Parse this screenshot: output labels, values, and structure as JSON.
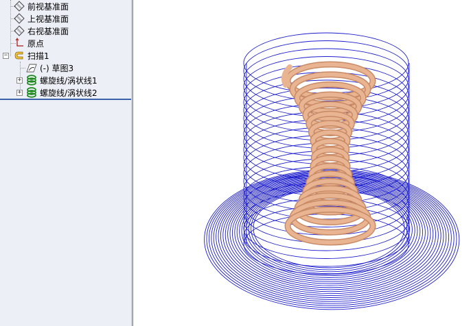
{
  "feature_tree": {
    "items": [
      {
        "label": "前视基准面",
        "icon": "plane-icon"
      },
      {
        "label": "上视基准面",
        "icon": "plane-icon"
      },
      {
        "label": "右视基准面",
        "icon": "plane-icon"
      },
      {
        "label": "原点",
        "icon": "origin-icon"
      },
      {
        "label": "扫描1",
        "icon": "sweep-icon",
        "expanded": true
      },
      {
        "label": "(-) 草图3",
        "icon": "sketch-icon"
      },
      {
        "label": "螺旋线/涡状线1",
        "icon": "helix-icon"
      },
      {
        "label": "螺旋线/涡状线2",
        "icon": "helix-icon"
      }
    ],
    "expand_symbols": {
      "collapse": "−",
      "expand": "+"
    }
  },
  "viewport": {
    "model": "swept coil spring with helix and spiral curves",
    "colors": {
      "curve": "#1a1acd",
      "solid": "#e8b491",
      "solid_shadow": "#c98a66",
      "background": "#ffffff"
    }
  }
}
